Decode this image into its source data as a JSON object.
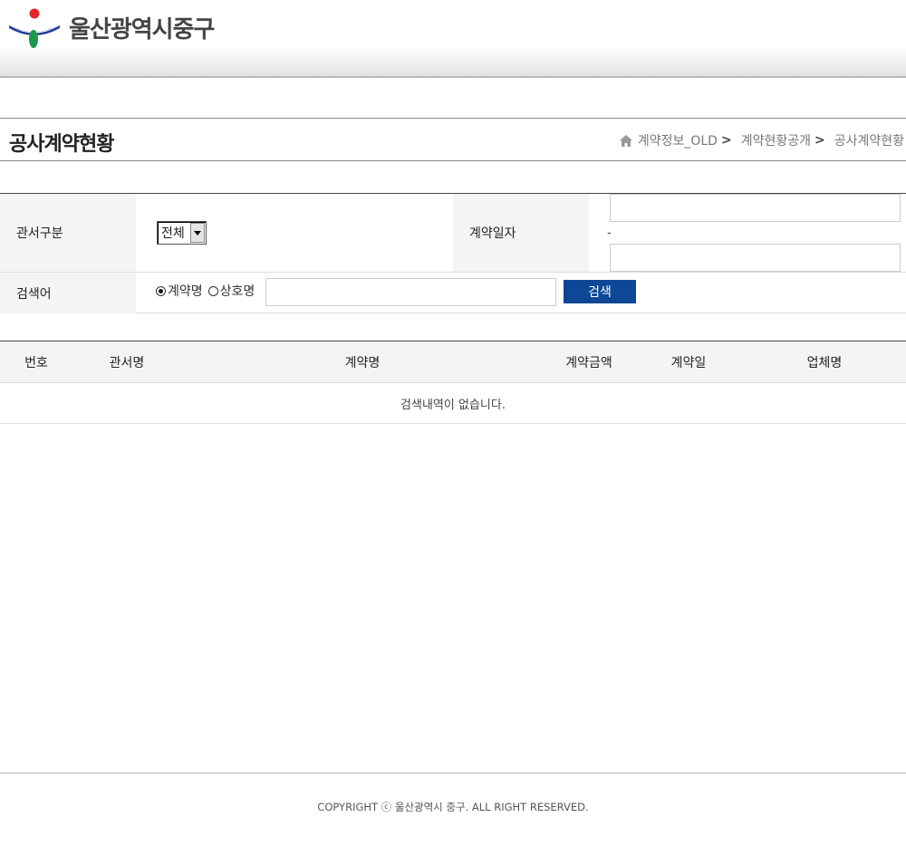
{
  "header": {
    "logo_text": "울산광역시중구",
    "colors": {
      "logo_blue": "#223f9a",
      "logo_red": "#e2262c",
      "logo_green": "#1a9a4a"
    }
  },
  "title_bar": {
    "title": "공사계약현황",
    "breadcrumb": [
      {
        "label": "계약정보_OLD",
        "sep": ">"
      },
      {
        "label": "계약현황공개",
        "sep": ">"
      },
      {
        "label": "공사계약현황",
        "sep": ""
      }
    ]
  },
  "search": {
    "dept_label": "관서구분",
    "dept_select": {
      "value": "전체"
    },
    "date_label": "계약일자",
    "date_range_separator": "-",
    "date_from": {
      "value": ""
    },
    "date_to": {
      "value": ""
    },
    "keyword_label": "검색어",
    "radio_options": [
      {
        "label": "계약명",
        "checked": true
      },
      {
        "label": "상호명",
        "checked": false
      }
    ],
    "keyword_input": {
      "value": ""
    },
    "search_button": "검색",
    "button_color": "#0e4796"
  },
  "results": {
    "columns": [
      "번호",
      "관서명",
      "계약명",
      "계약금액",
      "계약일",
      "업체명"
    ],
    "rows": [],
    "empty_message": "검색내역이 없습니다."
  },
  "footer": {
    "copyright": "COPYRIGHT ⓒ 울산광역시 중구. ALL RIGHT RESERVED."
  }
}
